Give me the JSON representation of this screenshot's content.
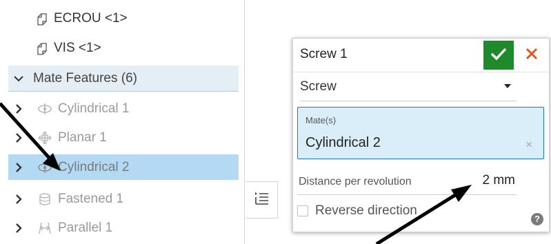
{
  "tree": {
    "parts": [
      {
        "label": "ECROU <1>",
        "icon": "part-icon"
      },
      {
        "label": "VIS <1>",
        "icon": "part-icon"
      }
    ],
    "mate_features_header": "Mate Features (6)",
    "features": [
      {
        "label": "Cylindrical 1",
        "icon": "cylindrical-mate-icon",
        "state": "suppressed"
      },
      {
        "label": "Planar 1",
        "icon": "planar-mate-icon",
        "state": "suppressed"
      },
      {
        "label": "Cylindrical 2",
        "icon": "cylindrical-mate-icon",
        "state": "selected"
      },
      {
        "label": "Fastened 1",
        "icon": "fastened-mate-icon",
        "state": "suppressed"
      },
      {
        "label": "Parallel 1",
        "icon": "parallel-mate-icon",
        "state": "suppressed"
      }
    ]
  },
  "dialog": {
    "title": "Screw 1",
    "type_value": "Screw",
    "mates_label": "Mate(s)",
    "mates_value": "Cylindrical 2",
    "mates_clear": "×",
    "distance_label": "Distance per revolution",
    "distance_value": "2 mm",
    "reverse_label": "Reverse direction",
    "reverse_checked": false,
    "help_glyph": "?"
  },
  "colors": {
    "ok_green": "#1f8a2c",
    "cancel_orange": "#e2541b",
    "selection_blue": "#b3d9f3",
    "field_focus": "#1e74c9"
  }
}
